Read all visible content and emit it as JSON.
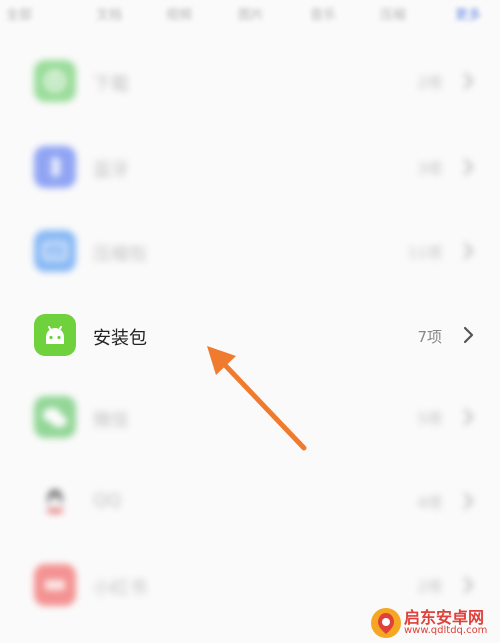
{
  "tabs": [
    {
      "label": "全部"
    },
    {
      "label": "文档"
    },
    {
      "label": "视频"
    },
    {
      "label": "图片"
    },
    {
      "label": "音乐"
    },
    {
      "label": "压缩"
    },
    {
      "label": "更多"
    }
  ],
  "rows": [
    {
      "label": "下载",
      "count": "2项",
      "icon": "download-icon",
      "color": "#5cc95c",
      "blurred": true
    },
    {
      "label": "蓝牙",
      "count": "3项",
      "icon": "bluetooth-icon",
      "color": "#4a6cf0",
      "blurred": true
    },
    {
      "label": "压缩包",
      "count": "11项",
      "icon": "zip-icon",
      "color": "#3f8ef2",
      "blurred": true
    },
    {
      "label": "安装包",
      "count": "7项",
      "icon": "android-icon",
      "color": "#6fd23c",
      "blurred": false
    },
    {
      "label": "微信",
      "count": "5项",
      "icon": "wechat-icon",
      "color": "#4fbf56",
      "blurred": true
    },
    {
      "label": "QQ",
      "count": "4项",
      "icon": "qq-icon",
      "color": "#f0f0f0",
      "blurred": true
    },
    {
      "label": "小红书",
      "count": "2项",
      "icon": "xiaohongshu-icon",
      "color": "#f04e4e",
      "blurred": true
    }
  ],
  "watermark": {
    "title": "启东安卓网",
    "url": "www.qdltdq.com"
  }
}
